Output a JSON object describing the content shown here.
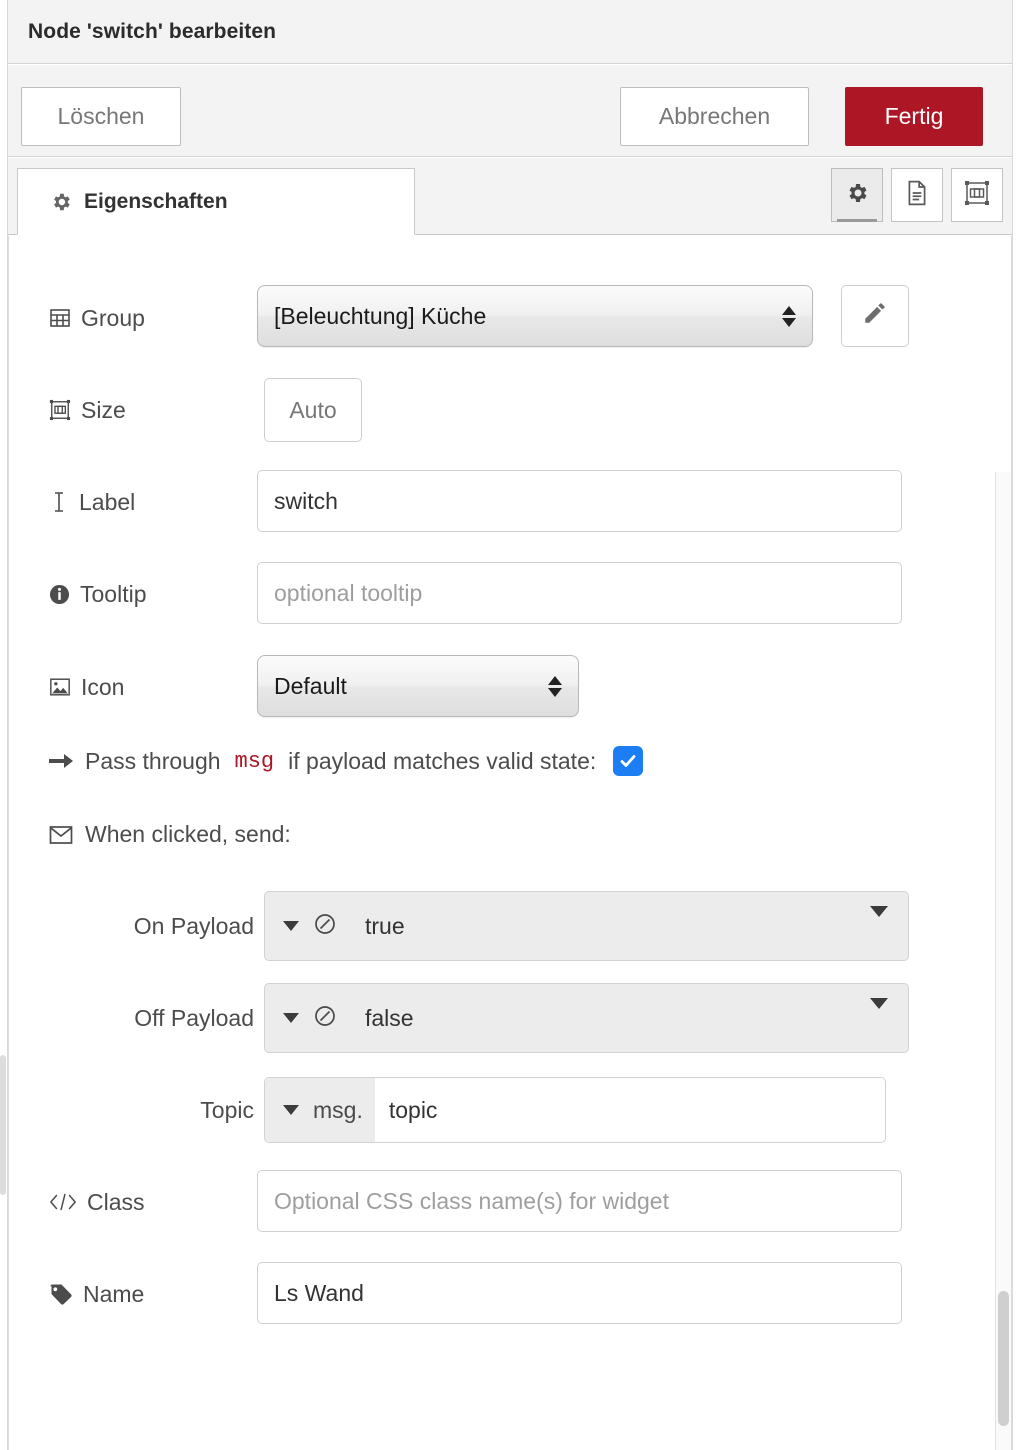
{
  "window": {
    "title": "Node 'switch' bearbeiten"
  },
  "toolbar": {
    "delete_label": "Löschen",
    "cancel_label": "Abbrechen",
    "done_label": "Fertig",
    "done_color": "#ad1625"
  },
  "tabs": {
    "active_tab_label": "Eigenschaften",
    "icon_buttons": [
      {
        "name": "properties",
        "icon": "gear-icon",
        "active": true
      },
      {
        "name": "description",
        "icon": "document-icon",
        "active": false
      },
      {
        "name": "appearance",
        "icon": "appearance-icon",
        "active": false
      }
    ]
  },
  "form": {
    "group": {
      "label": "Group",
      "icon": "table-icon",
      "value": "[Beleuchtung] Küche",
      "edit_button_icon": "pencil-icon"
    },
    "size": {
      "label": "Size",
      "icon": "resize-icon",
      "value": "Auto"
    },
    "label_field": {
      "label": "Label",
      "icon": "text-cursor-icon",
      "value": "switch"
    },
    "tooltip": {
      "label": "Tooltip",
      "icon": "info-circle-icon",
      "value": "",
      "placeholder": "optional tooltip"
    },
    "icon_field": {
      "label": "Icon",
      "icon": "image-icon",
      "value": "Default"
    },
    "passthrough": {
      "icon": "arrow-right-icon",
      "text_before": "Pass through",
      "msg_token": "msg",
      "text_after": "if payload matches valid state:",
      "checked": true,
      "checkbox_color": "#1d7ef4"
    },
    "when_clicked": {
      "icon": "envelope-icon",
      "label": "When clicked, send:"
    },
    "on_payload": {
      "label": "On Payload",
      "type_icon": "boolean-icon",
      "value": "true"
    },
    "off_payload": {
      "label": "Off Payload",
      "type_icon": "boolean-icon",
      "value": "false"
    },
    "topic": {
      "label": "Topic",
      "prefix": "msg.",
      "value": "topic"
    },
    "css_class": {
      "label": "Class",
      "icon": "code-icon",
      "value": "",
      "placeholder": "Optional CSS class name(s) for widget"
    },
    "name": {
      "label": "Name",
      "icon": "tag-icon",
      "value": "Ls Wand"
    }
  }
}
